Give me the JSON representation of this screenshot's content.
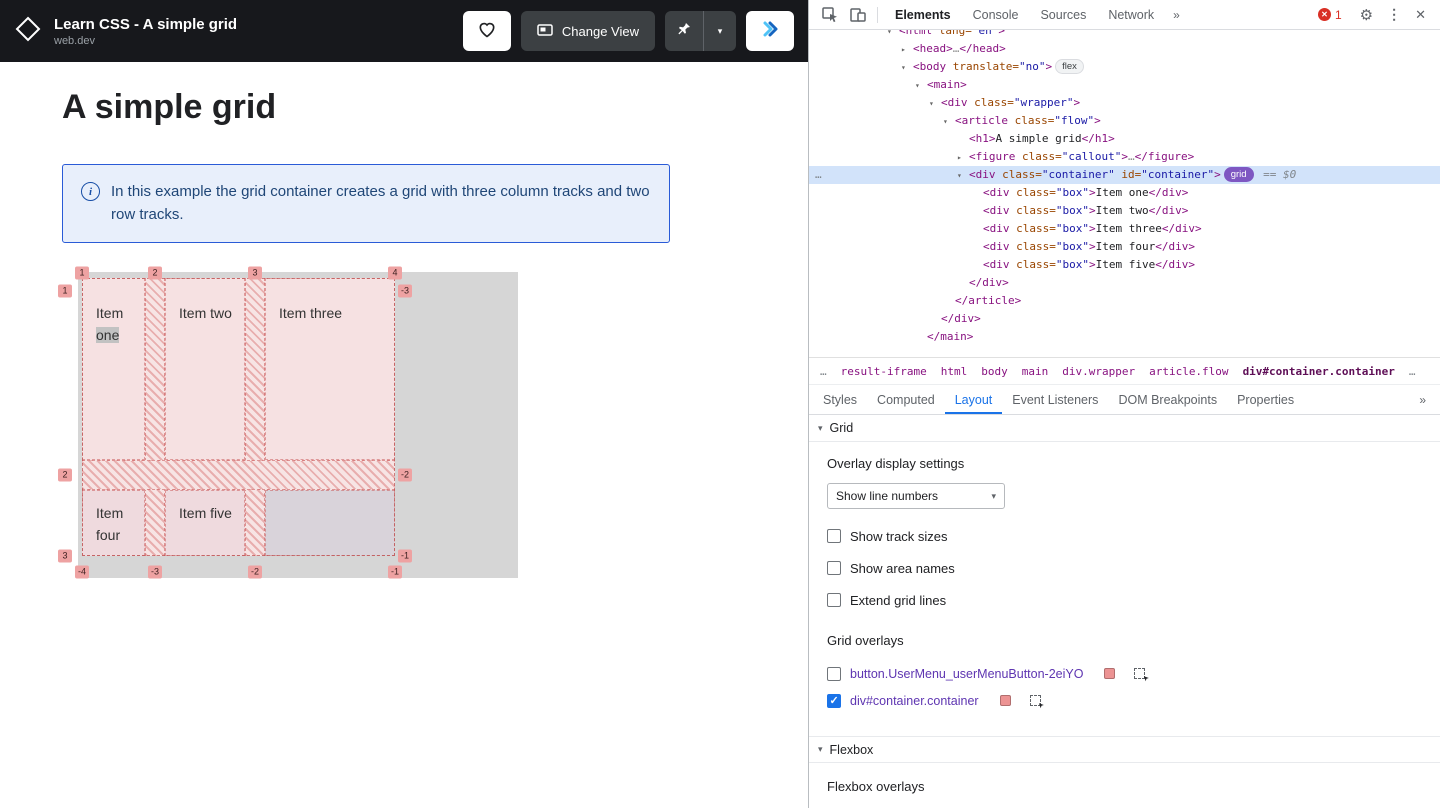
{
  "colors": {
    "accent_blue": "#1a73e8",
    "selection_blue": "#d2e3fa",
    "grid_badge_purple": "#7e57c2",
    "overlay_swatch_salmon": "#ec9393",
    "line_badge_salmon": "#eea2a2",
    "callout_blue": "#174ea6",
    "error_red": "#d93025"
  },
  "browser": {
    "header": {
      "title": "Learn CSS - A simple grid",
      "subtitle": "web.dev",
      "change_view_label": "Change View"
    },
    "page": {
      "heading": "A simple grid",
      "callout_text": "In this example the grid container creates a grid with three column tracks and two row tracks.",
      "grid": {
        "items": [
          {
            "pre": "Item",
            "hl": "one"
          },
          {
            "label": "Item two"
          },
          {
            "label": "Item three"
          },
          {
            "label": "Item four"
          },
          {
            "label": "Item five"
          }
        ],
        "line_numbers": {
          "top": [
            "1",
            "2",
            "3",
            "4"
          ],
          "left": [
            "1",
            "2",
            "3"
          ],
          "right": [
            "-3",
            "-2",
            "-1"
          ],
          "bottom": [
            "-4",
            "-3",
            "-2",
            "-1"
          ]
        }
      }
    }
  },
  "devtools": {
    "toolbar": {
      "tabs": [
        {
          "label": "Elements",
          "active": true
        },
        {
          "label": "Console"
        },
        {
          "label": "Sources"
        },
        {
          "label": "Network"
        }
      ],
      "overflow": "»",
      "error_count": "1"
    },
    "elements": {
      "lines": [
        {
          "p": 78,
          "a": "v",
          "toks": [
            [
              "t",
              "<html "
            ],
            [
              "a",
              "lang="
            ],
            [
              "v",
              "\"en\""
            ],
            [
              "t",
              ">"
            ]
          ]
        },
        {
          "p": 92,
          "a": ">",
          "toks": [
            [
              "t",
              "<head>"
            ],
            [
              "g",
              "…"
            ],
            [
              "t",
              "</head>"
            ]
          ]
        },
        {
          "p": 92,
          "a": "v",
          "toks": [
            [
              "t",
              "<body "
            ],
            [
              "a",
              "translate="
            ],
            [
              "v",
              "\"no\""
            ],
            [
              "t",
              ">"
            ],
            [
              "bf",
              "flex"
            ]
          ]
        },
        {
          "p": 106,
          "a": "v",
          "toks": [
            [
              "t",
              "<main>"
            ]
          ]
        },
        {
          "p": 120,
          "a": "v",
          "toks": [
            [
              "t",
              "<div "
            ],
            [
              "a",
              "class="
            ],
            [
              "v",
              "\"wrapper\""
            ],
            [
              "t",
              ">"
            ]
          ]
        },
        {
          "p": 134,
          "a": "v",
          "toks": [
            [
              "t",
              "<article "
            ],
            [
              "a",
              "class="
            ],
            [
              "v",
              "\"flow\""
            ],
            [
              "t",
              ">"
            ]
          ]
        },
        {
          "p": 148,
          "a": null,
          "toks": [
            [
              "t",
              "<h1>"
            ],
            [
              "x",
              "A simple grid"
            ],
            [
              "t",
              "</h1>"
            ]
          ]
        },
        {
          "p": 148,
          "a": ">",
          "toks": [
            [
              "t",
              "<figure "
            ],
            [
              "a",
              "class="
            ],
            [
              "v",
              "\"callout\""
            ],
            [
              "t",
              ">"
            ],
            [
              "g",
              "…"
            ],
            [
              "t",
              "</figure>"
            ]
          ]
        },
        {
          "p": 148,
          "a": "v",
          "sel": true,
          "gut": "…",
          "toks": [
            [
              "t",
              "<div "
            ],
            [
              "a",
              "class="
            ],
            [
              "v",
              "\"container\""
            ],
            [
              "a",
              " id="
            ],
            [
              "v",
              "\"container\""
            ],
            [
              "t",
              ">"
            ],
            [
              "bg",
              "grid"
            ],
            [
              "m",
              " == $0"
            ]
          ]
        },
        {
          "p": 162,
          "a": null,
          "toks": [
            [
              "t",
              "<div "
            ],
            [
              "a",
              "class="
            ],
            [
              "v",
              "\"box\""
            ],
            [
              "t",
              ">"
            ],
            [
              "x",
              "Item one"
            ],
            [
              "t",
              "</div>"
            ]
          ]
        },
        {
          "p": 162,
          "a": null,
          "toks": [
            [
              "t",
              "<div "
            ],
            [
              "a",
              "class="
            ],
            [
              "v",
              "\"box\""
            ],
            [
              "t",
              ">"
            ],
            [
              "x",
              "Item two"
            ],
            [
              "t",
              "</div>"
            ]
          ]
        },
        {
          "p": 162,
          "a": null,
          "toks": [
            [
              "t",
              "<div "
            ],
            [
              "a",
              "class="
            ],
            [
              "v",
              "\"box\""
            ],
            [
              "t",
              ">"
            ],
            [
              "x",
              "Item three"
            ],
            [
              "t",
              "</div>"
            ]
          ]
        },
        {
          "p": 162,
          "a": null,
          "toks": [
            [
              "t",
              "<div "
            ],
            [
              "a",
              "class="
            ],
            [
              "v",
              "\"box\""
            ],
            [
              "t",
              ">"
            ],
            [
              "x",
              "Item four"
            ],
            [
              "t",
              "</div>"
            ]
          ]
        },
        {
          "p": 162,
          "a": null,
          "toks": [
            [
              "t",
              "<div "
            ],
            [
              "a",
              "class="
            ],
            [
              "v",
              "\"box\""
            ],
            [
              "t",
              ">"
            ],
            [
              "x",
              "Item five"
            ],
            [
              "t",
              "</div>"
            ]
          ]
        },
        {
          "p": 148,
          "a": null,
          "toks": [
            [
              "t",
              "</div>"
            ]
          ]
        },
        {
          "p": 134,
          "a": null,
          "toks": [
            [
              "t",
              "</article>"
            ]
          ]
        },
        {
          "p": 120,
          "a": null,
          "toks": [
            [
              "t",
              "</div>"
            ]
          ]
        },
        {
          "p": 106,
          "a": null,
          "toks": [
            [
              "t",
              "</main>"
            ]
          ]
        }
      ]
    },
    "crumbs": [
      {
        "label": "…",
        "muted": true
      },
      {
        "label": "result-iframe"
      },
      {
        "label": "html"
      },
      {
        "label": "body"
      },
      {
        "label": "main"
      },
      {
        "label": "div.wrapper"
      },
      {
        "label": "article.flow"
      },
      {
        "label": "div#container.container",
        "current": true
      },
      {
        "label": "…",
        "muted": true
      }
    ],
    "subtabs": {
      "tabs": [
        {
          "label": "Styles"
        },
        {
          "label": "Computed"
        },
        {
          "label": "Layout",
          "active": true
        },
        {
          "label": "Event Listeners"
        },
        {
          "label": "DOM Breakpoints"
        },
        {
          "label": "Properties"
        }
      ],
      "overflow": "»"
    },
    "layout_pane": {
      "grid": {
        "title": "Grid",
        "settings_title": "Overlay display settings",
        "select_value": "Show line numbers",
        "checkboxes": [
          {
            "label": "Show track sizes",
            "checked": false
          },
          {
            "label": "Show area names",
            "checked": false
          },
          {
            "label": "Extend grid lines",
            "checked": false
          }
        ],
        "overlays_title": "Grid overlays",
        "overlays": [
          {
            "label": "button.UserMenu_userMenuButton-2eiYO",
            "checked": false
          },
          {
            "label": "div#container.container",
            "checked": true
          }
        ]
      },
      "flexbox": {
        "title": "Flexbox",
        "overlays_title": "Flexbox overlays"
      }
    }
  }
}
